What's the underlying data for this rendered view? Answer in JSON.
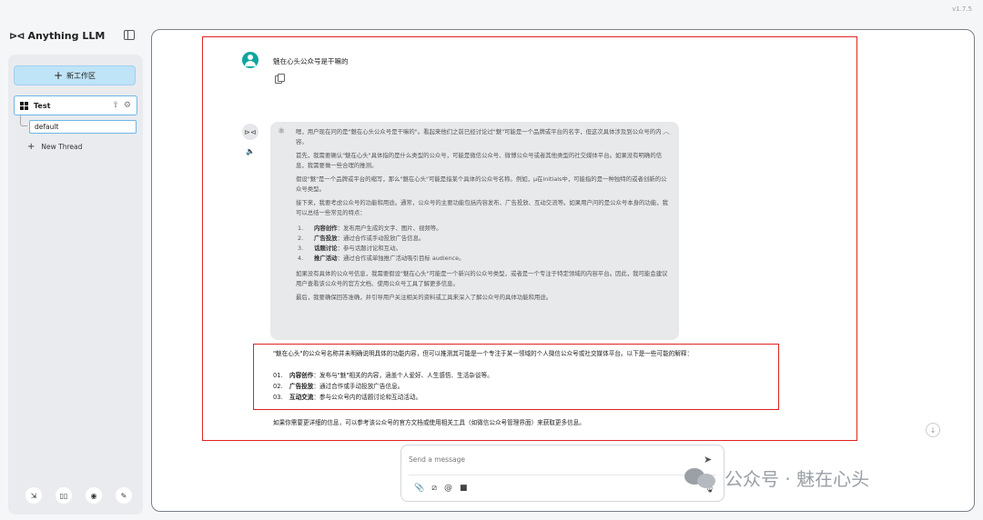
{
  "version": "v1.7.5",
  "app": {
    "title": "Anything LLM"
  },
  "sidebar": {
    "new_workspace_label": "新工作区",
    "workspace": {
      "name": "Test"
    },
    "thread_default": "default",
    "new_thread_label": "New Thread",
    "footer_icons": [
      "community-hub-icon",
      "docs-icon",
      "github-icon",
      "settings-icon"
    ]
  },
  "chat": {
    "user_message": "魅在心头公众号是干嘛的",
    "thought": {
      "p1": "嗯，用户现在问的是\"魅在心头公众号是干嘛的\"。看起来他们之前已经讨论过\"魅\"可能是一个品牌或平台的名字，但这次具体涉及到公众号的内容。",
      "p2": "首先，我需要确认\"魅在心头\"具体指的是什么类型的公众号，可能是微信公众号、微博公众号或者其他类型的社交媒体平台。如果没有明确的信息，我需要做一些合理的推测。",
      "p3": "假设\"魅\"是一个品牌或平台的缩写，那么\"魅在心头\"可能是指某个具体的公众号名称。例如，μ在initials中，可能指的是一种独特的或者创新的公众号类型。",
      "p4": "接下来，我要考虑公众号的功能和用途。通常，公众号的主要功能包括内容发布、广告投放、互动交流等。如果用户问的是公众号本身的功能，我可以总结一些常见的特点：",
      "list": [
        {
          "n": "1.",
          "title": "内容创作",
          "text": "：发布用户生成的文字、图片、视频等。"
        },
        {
          "n": "2.",
          "title": "广告投放",
          "text": "：通过合作或手动投放广告信息。"
        },
        {
          "n": "3.",
          "title": "话题讨论",
          "text": "：参与话题讨论和互动。"
        },
        {
          "n": "4.",
          "title": "推广活动",
          "text": "：通过合作或单独推广活动吸引目标 audience。"
        }
      ],
      "p5": "如果没有具体的公众号信息，我需要假设\"魅在心头\"可能是一个新兴的公众号类型，或者是一个专注于特定领域的内容平台。因此，我可能会建议用户查看该公众号的官方文档、使用公众号工具了解更多信息。",
      "p6": "最后，我要确保回答准确，并引导用户关注相关的资料或工具来深入了解公众号的具体功能和用途。"
    },
    "answer": {
      "intro": "\"魅在心头\"的公众号名称并未明确说明具体的功能内容，但可以推测其可能是一个专注于某一领域的个人微信公众号或社交媒体平台。以下是一些可能的解释：",
      "list": [
        {
          "n": "01.",
          "title": "内容创作",
          "text": "：发布与\"魅\"相关的内容，涵盖个人爱好、人生感悟、生活杂谈等。"
        },
        {
          "n": "02.",
          "title": "广告投放",
          "text": "：通过合作或手动投放广告信息。"
        },
        {
          "n": "03.",
          "title": "互动交流",
          "text": "：参与公众号内的话题讨论和互动活动。"
        }
      ],
      "tail": "如果你需要更详细的信息，可以参考该公众号的官方文档或使用相关工具（如微信公众号管理界面）来获取更多信息。"
    }
  },
  "composer": {
    "placeholder": "Send a message"
  },
  "watermark": "公众号 · 魅在心头"
}
